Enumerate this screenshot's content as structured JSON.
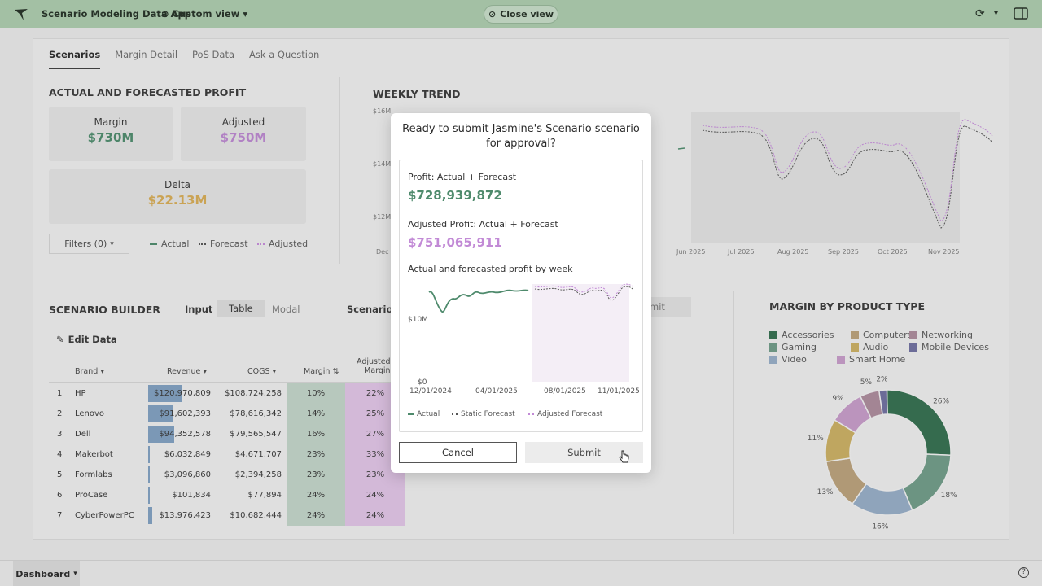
{
  "topbar": {
    "app_title": "Scenario Modeling Data App",
    "view_label": "Custom view",
    "close_view_label": "Close view"
  },
  "tabs": [
    {
      "label": "Scenarios"
    },
    {
      "label": "Margin Detail"
    },
    {
      "label": "PoS Data"
    },
    {
      "label": "Ask a Question"
    }
  ],
  "profit": {
    "title": "ACTUAL AND FORECASTED PROFIT",
    "margin_label": "Margin",
    "margin_value": "$730M",
    "adjusted_label": "Adjusted",
    "adjusted_value": "$750M",
    "delta_label": "Delta",
    "delta_value": "$22.13M",
    "filters_label": "Filters (0)",
    "legend_actual": "Actual",
    "legend_forecast": "Forecast",
    "legend_adjusted": "Adjusted"
  },
  "weekly_trend": {
    "title": "WEEKLY TREND",
    "y_ticks": [
      "$16M",
      "$14M",
      "$12M"
    ],
    "x_first": "Dec",
    "x_ticks": [
      "Jun 2025",
      "Jul 2025",
      "Aug 2025",
      "Sep 2025",
      "Oct 2025",
      "Nov 2025"
    ]
  },
  "builder": {
    "title": "SCENARIO BUILDER",
    "input_label": "Input",
    "table_label": "Table",
    "modal_label": "Modal",
    "scenario_label": "Scenario",
    "submit_partial": "omit",
    "edit_data": "Edit Data",
    "headers": {
      "brand": "Brand",
      "revenue": "Revenue",
      "cogs": "COGS",
      "margin": "Margin",
      "adjusted_margin_1": "Adjusted",
      "adjusted_margin_2": "Margin"
    },
    "rows": [
      {
        "num": "1",
        "brand": "HP",
        "revenue": "$120,970,809",
        "cogs": "$108,724,258",
        "margin": "10%",
        "adj": "22%",
        "bar": 1.0
      },
      {
        "num": "2",
        "brand": "Lenovo",
        "revenue": "$91,602,393",
        "cogs": "$78,616,342",
        "margin": "14%",
        "adj": "25%",
        "bar": 0.76
      },
      {
        "num": "3",
        "brand": "Dell",
        "revenue": "$94,352,578",
        "cogs": "$79,565,547",
        "margin": "16%",
        "adj": "27%",
        "bar": 0.78
      },
      {
        "num": "4",
        "brand": "Makerbot",
        "revenue": "$6,032,849",
        "cogs": "$4,671,707",
        "margin": "23%",
        "adj": "33%",
        "bar": 0.05
      },
      {
        "num": "5",
        "brand": "Formlabs",
        "revenue": "$3,096,860",
        "cogs": "$2,394,258",
        "margin": "23%",
        "adj": "23%",
        "bar": 0.03
      },
      {
        "num": "6",
        "brand": "ProCase",
        "revenue": "$101,834",
        "cogs": "$77,894",
        "margin": "24%",
        "adj": "24%",
        "bar": 0.01
      },
      {
        "num": "7",
        "brand": "CyberPowerPC",
        "revenue": "$13,976,423",
        "cogs": "$10,682,444",
        "margin": "24%",
        "adj": "24%",
        "bar": 0.12
      }
    ]
  },
  "margin_by_type": {
    "title": "MARGIN BY PRODUCT TYPE",
    "legend": [
      {
        "label": "Accessories",
        "color": "#356e4f"
      },
      {
        "label": "Computers",
        "color": "#b79f7a"
      },
      {
        "label": "Networking",
        "color": "#a98a9a"
      },
      {
        "label": "Gaming",
        "color": "#6f9a86"
      },
      {
        "label": "Audio",
        "color": "#c7ad62"
      },
      {
        "label": "Mobile Devices",
        "color": "#6f6f9e"
      },
      {
        "label": "Video",
        "color": "#94aac3"
      },
      {
        "label": "Smart Home",
        "color": "#c39ac5"
      }
    ]
  },
  "chart_data": {
    "type": "pie",
    "categories": [
      "Accessories",
      "Gaming",
      "Video",
      "Computers",
      "Audio",
      "Smart Home",
      "Networking",
      "Mobile Devices"
    ],
    "values": [
      26,
      18,
      16,
      13,
      11,
      9,
      5,
      2
    ],
    "labels": [
      "26%",
      "18%",
      "16%",
      "13%",
      "11%",
      "9%",
      "5%",
      "2%"
    ]
  },
  "modal": {
    "title": "Ready to submit Jasmine's Scenario scenario for approval?",
    "profit_label": "Profit: Actual + Forecast",
    "profit_value": "$728,939,872",
    "adj_profit_label": "Adjusted Profit: Actual + Forecast",
    "adj_profit_value": "$751,065,911",
    "chart_title": "Actual and forecasted profit by week",
    "y_ticks": [
      "$10M",
      "$0"
    ],
    "x_ticks": [
      "12/01/2024",
      "04/01/2025",
      "08/01/2025",
      "11/01/2025"
    ],
    "legend_actual": "Actual",
    "legend_static": "Static Forecast",
    "legend_adjusted": "Adjusted Forecast",
    "cancel_label": "Cancel",
    "submit_label": "Submit"
  },
  "bottombar": {
    "dashboard_label": "Dashboard"
  },
  "colors": {
    "green": "#4e8a6c",
    "purple": "#c28ad6",
    "gold": "#d3a956",
    "topbar": "#a9c8ab"
  }
}
